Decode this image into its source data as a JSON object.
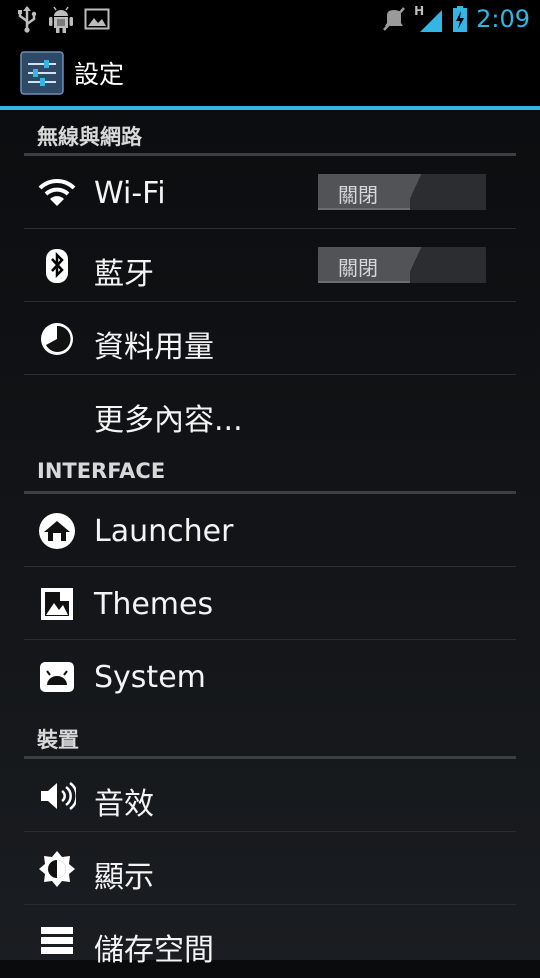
{
  "status_bar": {
    "time": "2:09",
    "network_type": "H",
    "left_icons": [
      "usb-icon",
      "android-debug-icon",
      "image-icon"
    ],
    "right_icons": [
      "mute-icon",
      "signal-icon",
      "battery-charging-icon"
    ]
  },
  "action_bar": {
    "title": "設定",
    "icon": "settings-app-icon"
  },
  "sections": [
    {
      "header": "無線與網路"
    },
    {
      "header": "INTERFACE"
    },
    {
      "header": "裝置"
    }
  ],
  "items": {
    "wifi": {
      "label": "Wi-Fi",
      "icon": "wifi-icon",
      "toggle": "關閉"
    },
    "bluetooth": {
      "label": "藍牙",
      "icon": "bluetooth-icon",
      "toggle": "關閉"
    },
    "data_usage": {
      "label": "資料用量",
      "icon": "data-usage-icon"
    },
    "more": {
      "label": "更多內容..."
    },
    "launcher": {
      "label": "Launcher",
      "icon": "launcher-icon"
    },
    "themes": {
      "label": "Themes",
      "icon": "themes-icon"
    },
    "system": {
      "label": "System",
      "icon": "system-icon"
    },
    "sound": {
      "label": "音效",
      "icon": "sound-icon"
    },
    "display": {
      "label": "顯示",
      "icon": "display-icon"
    },
    "storage": {
      "label": "儲存空間",
      "icon": "storage-icon"
    }
  },
  "colors": {
    "accent": "#33b5e5",
    "background": "#121417",
    "divider": "#2a2c2f"
  }
}
